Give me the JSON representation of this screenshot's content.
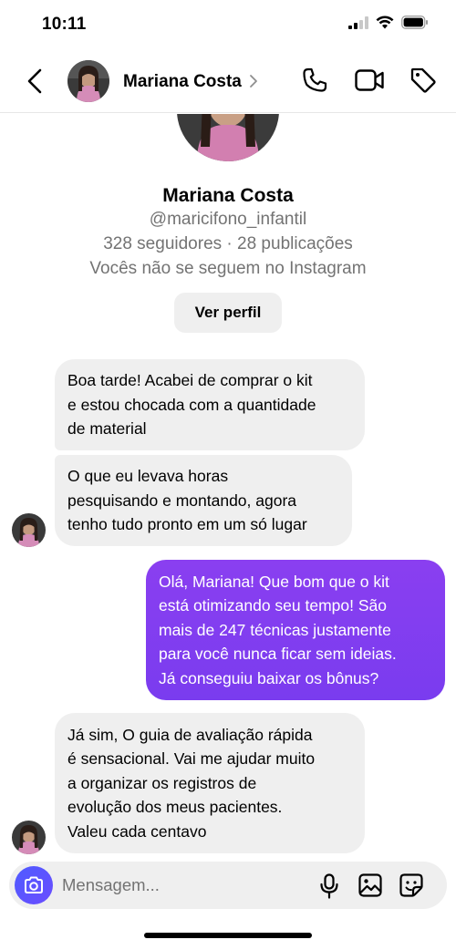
{
  "status": {
    "time": "10:11"
  },
  "header": {
    "contact_name": "Mariana Costa",
    "icons": [
      "back-icon",
      "chevron-right-icon",
      "phone-icon",
      "video-camera-icon",
      "tag-icon"
    ]
  },
  "profile": {
    "name": "Mariana Costa",
    "handle": "@maricifono_infantil",
    "stats": "328 seguidores · 28 publicações",
    "follow_note": "Vocês não se seguem no Instagram",
    "view_profile_label": "Ver perfil"
  },
  "messages": [
    {
      "sender": "Mariana Costa",
      "direction": "incoming",
      "lines": [
        "Boa tarde! Acabei de comprar o kit",
        "e estou chocada com a quantidade",
        "de material"
      ]
    },
    {
      "sender": "Mariana Costa",
      "direction": "incoming",
      "lines": [
        "O que eu levava horas",
        "pesquisando e montando, agora",
        "tenho tudo pronto em um só lugar"
      ]
    },
    {
      "sender": "me",
      "direction": "outgoing",
      "lines": [
        "Olá, Mariana! Que bom que o kit",
        "está otimizando seu tempo! São",
        "mais de 247 técnicas justamente",
        "para você nunca ficar sem ideias.",
        "Já conseguiu baixar os bônus?"
      ]
    },
    {
      "sender": "Mariana Costa",
      "direction": "incoming",
      "lines": [
        "Já sim, O guia de avaliação rápida",
        "é sensacional. Vai me ajudar muito",
        "a organizar os registros de",
        "evolução dos meus pacientes.",
        "Valeu cada centavo"
      ]
    }
  ],
  "composer": {
    "placeholder": "Mensagem...",
    "icons": [
      "camera-icon",
      "microphone-icon",
      "gallery-icon",
      "sticker-icon"
    ]
  },
  "colors": {
    "outgoing_bubble": "#7d3df0",
    "incoming_bubble": "#efefef",
    "camera_button": "#5851ff",
    "secondary_text": "#737373"
  }
}
